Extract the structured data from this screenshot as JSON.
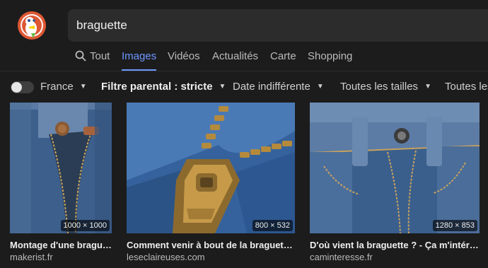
{
  "search": {
    "query": "braguette"
  },
  "tabs": [
    {
      "label": "Tout",
      "icon": "search-icon"
    },
    {
      "label": "Images",
      "active": true
    },
    {
      "label": "Vidéos"
    },
    {
      "label": "Actualités"
    },
    {
      "label": "Carte"
    },
    {
      "label": "Shopping"
    }
  ],
  "filters": {
    "region": "France",
    "safe_search": "Filtre parental : stricte",
    "date": "Date indifférente",
    "size": "Toutes les tailles",
    "type": "Toutes les"
  },
  "results": [
    {
      "dimensions": "1000 × 1000",
      "title": "Montage d'une braguette…",
      "source": "makerist.fr"
    },
    {
      "dimensions": "800 × 532",
      "title": "Comment venir à bout de la braguette…",
      "source": "leseclaireuses.com"
    },
    {
      "dimensions": "1280 × 853",
      "title": "D'où vient la braguette ? - Ça m'intéresse…",
      "source": "caminteresse.fr"
    }
  ],
  "colors": {
    "accent": "#6d97ff",
    "background": "#1c1c1c",
    "search_box": "#2c2c2c",
    "logo": "#de5833"
  }
}
